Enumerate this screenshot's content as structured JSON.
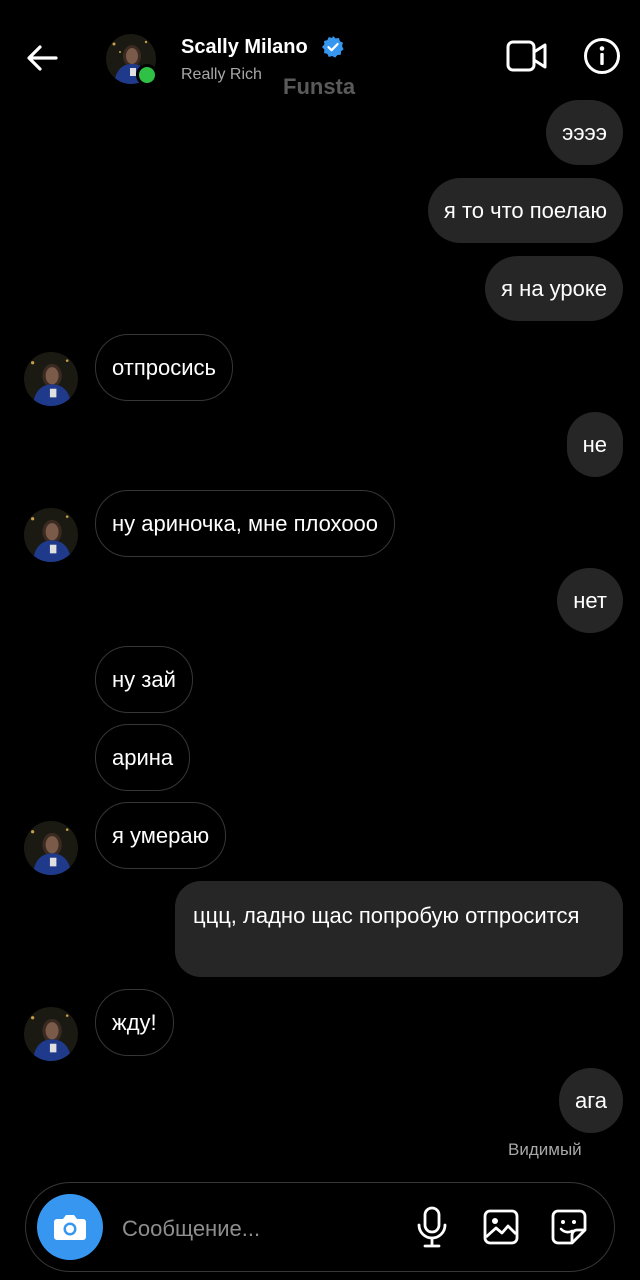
{
  "header": {
    "name": "Scally Milano",
    "subtitle": "Really Rich",
    "watermark": "Funsta"
  },
  "messages": [
    {
      "from": "me",
      "text": "ээээ"
    },
    {
      "from": "me",
      "text": "я то что поелаю"
    },
    {
      "from": "me",
      "text": "я на уроке"
    },
    {
      "from": "them",
      "text": "отпросись"
    },
    {
      "from": "me",
      "text": "не"
    },
    {
      "from": "them",
      "text": "ну ариночка, мне плохооо"
    },
    {
      "from": "me",
      "text": "нет"
    },
    {
      "from": "them",
      "text": "ну зай"
    },
    {
      "from": "them",
      "text": "арина"
    },
    {
      "from": "them",
      "text": "я умераю"
    },
    {
      "from": "me",
      "text": "ццц, ладно щас попробую отпросится"
    },
    {
      "from": "them",
      "text": "жду!"
    },
    {
      "from": "me",
      "text": "ага"
    }
  ],
  "status": "Видимый",
  "composer": {
    "placeholder": "Сообщение..."
  },
  "colors": {
    "background": "#000000",
    "outgoing_bubble": "#262626",
    "incoming_border": "#363636",
    "accent": "#3797f0",
    "online": "#2fc146"
  }
}
